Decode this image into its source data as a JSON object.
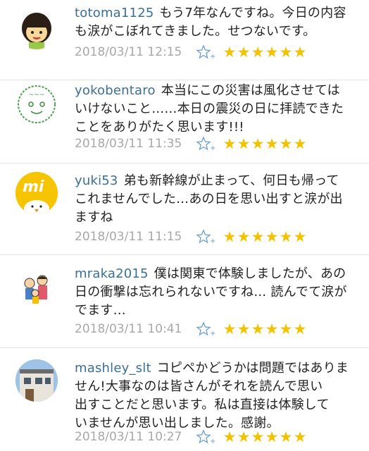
{
  "comments": [
    {
      "user": "totoma1125",
      "text_lines": [
        "もう7年なんですね。今日の内容",
        "も涙がこぼれてきました。せつないです。"
      ],
      "time": "2018/03/11 12:15",
      "avatar": "girl-avatar"
    },
    {
      "user": "yokobentaro",
      "text_lines": [
        "本当にこの災害は風化させては",
        "いけないこと……本日の震災の日に拝読できた",
        "ことをありがたく思います!!!"
      ],
      "time": "2018/03/11 11:35",
      "avatar": "stamp-avatar"
    },
    {
      "user": "yuki53",
      "text_lines": [
        "弟も新幹線が止まって、何日も帰って",
        "これませんでした…あの日を思い出すと涙が出",
        "ますね"
      ],
      "time": "2018/03/11 11:15",
      "avatar": "mi-chick-avatar"
    },
    {
      "user": "mraka2015",
      "text_lines": [
        "僕は関東で体験しましたが、あの",
        "日の衝撃は忘れられないですね… 読んでて涙が",
        "でます…"
      ],
      "time": "2018/03/11 10:41",
      "avatar": "family-avatar"
    },
    {
      "user": "mashley_slt",
      "text_lines": [
        "コピペかどうかは問題ではありま",
        "せん!大事なのは皆さんがそれを読んで思い",
        "出すことだと思います。私は直接は体験して",
        "いませんが思い出しました。感謝。"
      ],
      "time": "2018/03/11 10:27",
      "avatar": "house-avatar"
    }
  ],
  "star_glyph": "★",
  "star_count": 6,
  "colors": {
    "username": "#3a6f96",
    "star": "#f2c200",
    "timestamp": "#a8a8a8",
    "star_add": "#6a9ccc"
  }
}
